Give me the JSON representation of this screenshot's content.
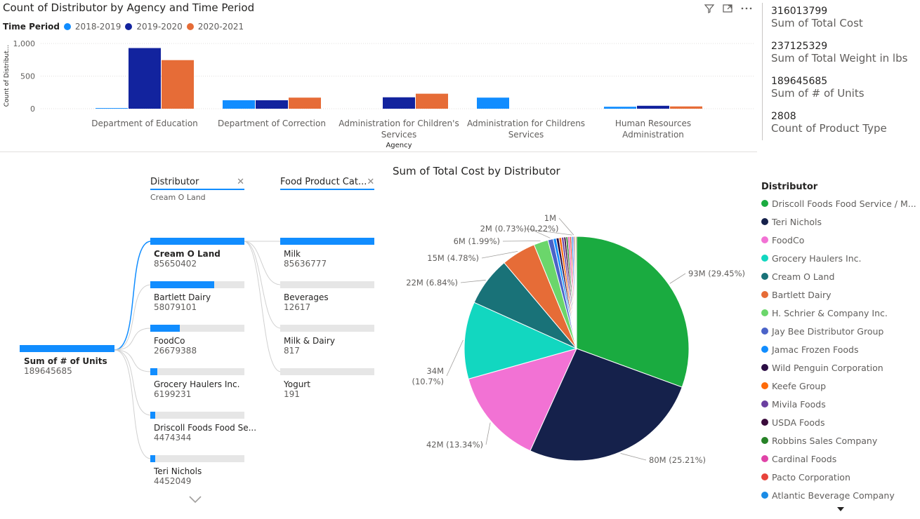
{
  "bar_chart": {
    "title": "Count of Distributor by Agency and Time Period",
    "legend_title": "Time Period",
    "ylabel": "Count of Distribut...",
    "xlabel": "Agency",
    "chart_data": {
      "type": "bar",
      "categories": [
        "Department of Education",
        "Department of Correction",
        "Administration for Children's Services",
        "Administration for Childrens Services",
        "Human Resources Administration"
      ],
      "category_lines": [
        [
          "Department of Education"
        ],
        [
          "Department of Correction"
        ],
        [
          "Administration for Children's",
          "Services"
        ],
        [
          "Administration for Childrens",
          "Services"
        ],
        [
          "Human Resources",
          "Administration"
        ]
      ],
      "series": [
        {
          "name": "2018-2019",
          "color": "#118dff",
          "values": [
            10,
            130,
            0,
            170,
            30
          ]
        },
        {
          "name": "2019-2020",
          "color": "#12239e",
          "values": [
            930,
            130,
            175,
            0,
            45
          ]
        },
        {
          "name": "2020-2021",
          "color": "#e66c37",
          "values": [
            745,
            170,
            230,
            0,
            35
          ]
        }
      ],
      "ylim": [
        0,
        1000
      ],
      "yticks": [
        0,
        500,
        1000
      ],
      "ytick_labels": [
        "0",
        "500",
        "1,000"
      ],
      "grid": true,
      "legend_position": "top-left"
    }
  },
  "toolbar": {
    "filter_icon": "filter-icon",
    "focus_icon": "focus-mode-icon",
    "more_icon": "more-options-icon"
  },
  "cards": [
    {
      "value": "316013799",
      "label": "Sum of Total Cost"
    },
    {
      "value": "237125329",
      "label": "Sum of Total Weight in lbs"
    },
    {
      "value": "189645685",
      "label": "Sum of # of Units"
    },
    {
      "value": "2808",
      "label": "Count of Product Type"
    }
  ],
  "tree": {
    "root": {
      "label": "Sum of # of Units",
      "value": "189645685",
      "fill": 1.0
    },
    "level1": {
      "header": "Distributor",
      "selected": "Cream O Land",
      "items": [
        {
          "label": "Cream O Land",
          "value": "85650402",
          "fill": 1.0,
          "selected": true
        },
        {
          "label": "Bartlett Dairy",
          "value": "58079101",
          "fill": 0.678
        },
        {
          "label": "FoodCo",
          "value": "26679388",
          "fill": 0.311
        },
        {
          "label": "Grocery Haulers Inc.",
          "value": "6199231",
          "fill": 0.072
        },
        {
          "label": "Driscoll Foods Food Se...",
          "value": "4474344",
          "fill": 0.052
        },
        {
          "label": "Teri Nichols",
          "value": "4452049",
          "fill": 0.052
        }
      ]
    },
    "level2": {
      "header": "Food Product Cat...",
      "items": [
        {
          "label": "Milk",
          "value": "85636777",
          "fill": 1.0
        },
        {
          "label": "Beverages",
          "value": "12617",
          "fill": 0.0
        },
        {
          "label": "Milk & Dairy",
          "value": "817",
          "fill": 0.0
        },
        {
          "label": "Yogurt",
          "value": "191",
          "fill": 0.0
        }
      ]
    },
    "more_icon": "chevron-down-icon"
  },
  "pie": {
    "title": "Sum of Total Cost by Distributor",
    "legend_title": "Distributor",
    "chart_data": {
      "type": "pie",
      "slices": [
        {
          "name": "Driscoll Foods Food Service / M...",
          "value": 93,
          "pct": 29.45,
          "label": "93M (29.45%)",
          "color": "#1aab40"
        },
        {
          "name": "Teri Nichols",
          "value": 80,
          "pct": 25.21,
          "label": "80M (25.21%)",
          "color": "#15214b"
        },
        {
          "name": "FoodCo",
          "value": 42,
          "pct": 13.34,
          "label": "42M (13.34%)",
          "color": "#f272d4"
        },
        {
          "name": "Grocery Haulers Inc.",
          "value": 34,
          "pct": 10.7,
          "label": "34M (10.7%)",
          "color": "#12d7c0"
        },
        {
          "name": "Cream O Land",
          "value": 22,
          "pct": 6.84,
          "label": "22M (6.84%)",
          "color": "#197278"
        },
        {
          "name": "Bartlett Dairy",
          "value": 15,
          "pct": 4.78,
          "label": "15M (4.78%)",
          "color": "#e66c37"
        },
        {
          "name": "H. Schrier & Company Inc.",
          "value": 6,
          "pct": 1.99,
          "label": "6M (1.99%)",
          "color": "#6bd66b"
        },
        {
          "name": "Jay Bee Distributor Group",
          "value": 2.3,
          "pct": 0.73,
          "label": "2M (0.73%)",
          "color": "#4b63c8"
        },
        {
          "name": "Jamac Frozen Foods",
          "value": 1.3,
          "pct": 0.42,
          "label": "",
          "color": "#118dff"
        },
        {
          "name": "Wild Penguin Corporation",
          "value": 1.2,
          "pct": 0.38,
          "label": "",
          "color": "#2b0d44"
        },
        {
          "name": "Keefe Group",
          "value": 1.1,
          "pct": 0.35,
          "label": "",
          "color": "#fe6b0a"
        },
        {
          "name": "Mivila Foods",
          "value": 1.0,
          "pct": 0.32,
          "label": "",
          "color": "#6b3fa0"
        },
        {
          "name": "USDA Foods",
          "value": 0.9,
          "pct": 0.29,
          "label": "",
          "color": "#3a0b3b"
        },
        {
          "name": "Robbins Sales Company",
          "value": 0.85,
          "pct": 0.27,
          "label": "",
          "color": "#278227"
        },
        {
          "name": "Cardinal Foods",
          "value": 0.8,
          "pct": 0.25,
          "label": "",
          "color": "#e044a7"
        },
        {
          "name": "Pacto Corporation",
          "value": 0.75,
          "pct": 0.24,
          "label": "",
          "color": "#e8433b"
        },
        {
          "name": "Atlantic Beverage Company",
          "value": 0.7,
          "pct": 0.22,
          "label": "(0.22%)",
          "color": "#1b8ce6"
        },
        {
          "name": "",
          "value": 0.6,
          "pct": 0.19,
          "label": "1M",
          "color": "#744ec2"
        },
        {
          "name": "",
          "value": 0.5,
          "pct": 0.16,
          "label": "",
          "color": "#d9b300"
        },
        {
          "name": "",
          "value": 0.45,
          "pct": 0.14,
          "label": "",
          "color": "#d64550"
        }
      ],
      "legend_position": "right"
    },
    "legend_more_icon": "caret-down-icon"
  }
}
